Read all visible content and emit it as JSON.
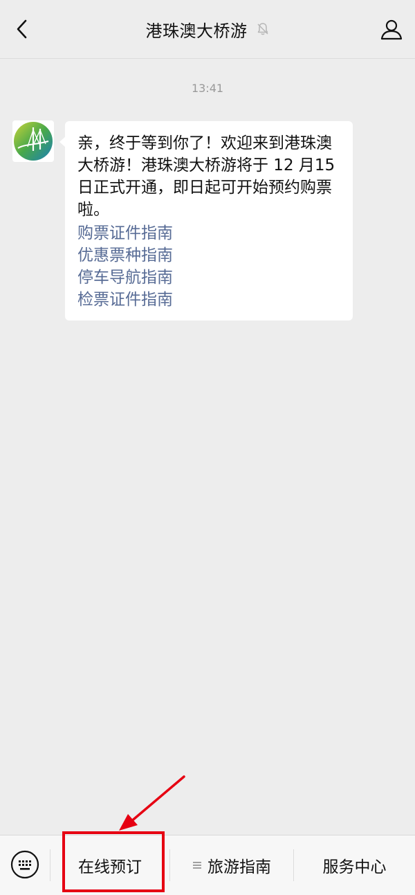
{
  "header": {
    "title": "港珠澳大桥游",
    "back_icon": "chevron-left-icon",
    "mute_icon": "bell-off-icon",
    "profile_icon": "person-icon"
  },
  "chat": {
    "timestamp": "13:41",
    "message": {
      "text": "亲，终于等到你了！欢迎来到港珠澳大桥游！港珠澳大桥游将于 12 月15 日正式开通，即日起可开始预约购票啦。",
      "links": [
        "购票证件指南",
        "优惠票种指南",
        "停车导航指南",
        "检票证件指南"
      ]
    }
  },
  "bottom_menu": {
    "keyboard_icon": "keyboard-icon",
    "items": [
      {
        "label": "在线预订"
      },
      {
        "label": "旅游指南",
        "icon": "menu-lines-icon"
      },
      {
        "label": "服务中心"
      }
    ]
  },
  "colors": {
    "link": "#576b95",
    "highlight": "#e60012",
    "background": "#ededed"
  }
}
